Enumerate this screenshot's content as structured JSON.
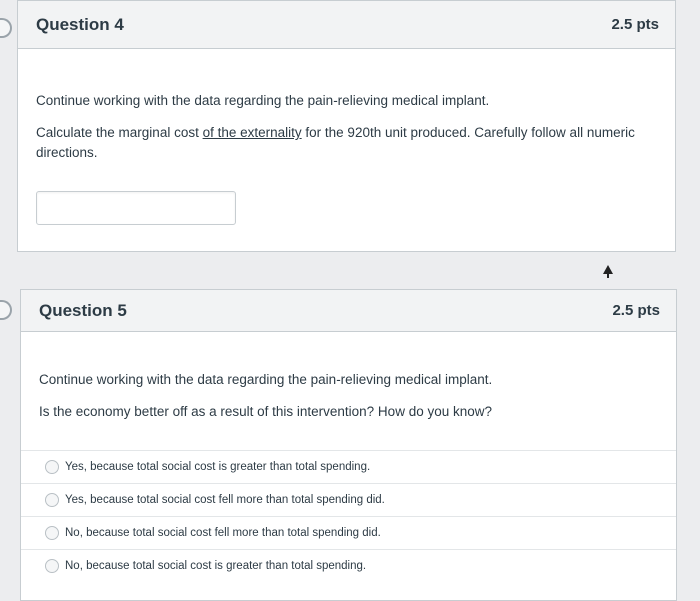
{
  "question4": {
    "title": "Question 4",
    "points": "2.5 pts",
    "text_line1": "Continue working with the data regarding the pain-relieving medical implant.",
    "text_line2_pre": "Calculate the marginal cost ",
    "text_line2_link": "of the externality",
    "text_line2_post": " for the 920th unit produced. Carefully follow all numeric directions.",
    "answer_value": ""
  },
  "question5": {
    "title": "Question 5",
    "points": "2.5 pts",
    "text_line1": "Continue working with the data regarding the pain-relieving medical implant.",
    "text_line2": "Is the economy better off as a result of this intervention? How do you know?",
    "options": [
      "Yes, because total social cost is greater than total spending.",
      "Yes, because total social cost fell more than total spending did.",
      "No, because total social cost fell more than total spending did.",
      "No, because total social cost is greater than total spending."
    ]
  },
  "icons": {
    "question_marker": "question-marker-icon",
    "cursor": "mouse-cursor-icon"
  }
}
